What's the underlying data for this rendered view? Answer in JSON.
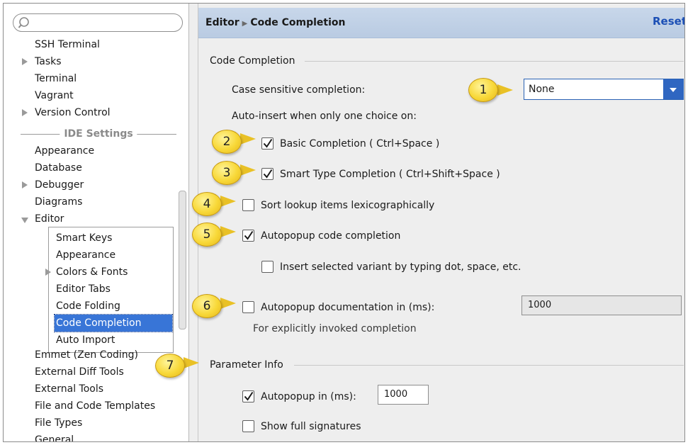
{
  "search": {
    "placeholder": ""
  },
  "tree": {
    "items": [
      {
        "label": "SSH Terminal"
      },
      {
        "label": "Tasks"
      },
      {
        "label": "Terminal"
      },
      {
        "label": "Vagrant"
      },
      {
        "label": "Version Control"
      },
      {
        "label": "Appearance"
      },
      {
        "label": "Database"
      },
      {
        "label": "Debugger"
      },
      {
        "label": "Diagrams"
      },
      {
        "label": "Editor"
      }
    ],
    "ide_settings_label": "IDE Settings",
    "editor_children": [
      {
        "label": "Smart Keys"
      },
      {
        "label": "Appearance"
      },
      {
        "label": "Colors & Fonts"
      },
      {
        "label": "Editor Tabs"
      },
      {
        "label": "Code Folding"
      },
      {
        "label": "Code Completion"
      },
      {
        "label": "Auto Import"
      }
    ],
    "after_items": [
      {
        "label": "Emmet (Zen Coding)"
      },
      {
        "label": "External Diff Tools"
      },
      {
        "label": "External Tools"
      },
      {
        "label": "File and Code Templates"
      },
      {
        "label": "File Types"
      },
      {
        "label": "General"
      }
    ]
  },
  "header": {
    "crumb_parent": "Editor",
    "crumb_current": "Code Completion",
    "reset_label": "Reset"
  },
  "code_completion": {
    "section_title": "Code Completion",
    "case_sensitive_label": "Case sensitive completion:",
    "case_sensitive_value": "None",
    "auto_insert_label": "Auto-insert when only one choice on:",
    "basic_completion": {
      "label": "Basic Completion ( Ctrl+Space )",
      "checked": true
    },
    "smart_type_completion": {
      "label": "Smart Type Completion ( Ctrl+Shift+Space )",
      "checked": true
    },
    "sort_lexicographically": {
      "label": "Sort lookup items lexicographically",
      "checked": false
    },
    "autopopup_completion": {
      "label": "Autopopup code completion",
      "checked": true
    },
    "insert_selected_variant": {
      "label": "Insert selected variant by typing dot, space, etc.",
      "checked": false
    },
    "autopopup_documentation": {
      "label": "Autopopup documentation in (ms):",
      "checked": false,
      "value": "1000"
    },
    "explicit_note": "For explicitly invoked completion"
  },
  "parameter_info": {
    "section_title": "Parameter Info",
    "autopopup": {
      "label": "Autopopup in (ms):",
      "checked": true,
      "value": "1000"
    },
    "show_full_signatures": {
      "label": "Show full signatures",
      "checked": false
    }
  },
  "callouts": [
    "1",
    "2",
    "3",
    "4",
    "5",
    "6",
    "7"
  ],
  "colors": {
    "selection": "#3875d7",
    "header_bg": "#c8d7ea",
    "combo_button": "#2f66c1",
    "callout_fill": "#f8d838",
    "reset_link": "#1c4fb5"
  }
}
